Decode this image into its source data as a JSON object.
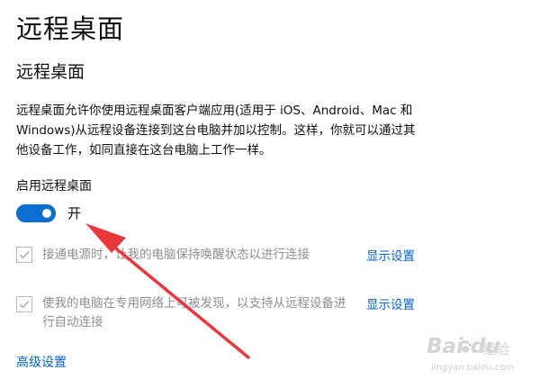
{
  "header": {
    "title": "远程桌面"
  },
  "section": {
    "title": "远程桌面",
    "description": "远程桌面允许你使用远程桌面客户端应用(适用于 iOS、Android、Mac 和 Windows)从远程设备连接到这台电脑并加以控制。这样，你就可以通过其他设备工作，如同直接在这台电脑上工作一样。"
  },
  "toggle": {
    "label": "启用远程桌面",
    "state_text": "开",
    "on": true,
    "color": "#0a6fd1"
  },
  "options": [
    {
      "text": "接通电源时，让我的电脑保持唤醒状态以进行连接",
      "link": "显示设置",
      "checked": true,
      "disabled": true
    },
    {
      "text": "使我的电脑在专用网络上可被发现，以支持从远程设备进行自动连接",
      "link": "显示设置",
      "checked": true,
      "disabled": true
    }
  ],
  "footer": {
    "advanced_link": "高级设置"
  },
  "annotation": {
    "type": "red-arrow",
    "color": "#e8383d"
  },
  "watermark": {
    "logo": "Bai  du",
    "sub": "经验",
    "url": "jingyan.baidu.com"
  },
  "colors": {
    "accent": "#0a6fd1",
    "link": "#0a63c4",
    "disabled_text": "#8f8f8f"
  }
}
